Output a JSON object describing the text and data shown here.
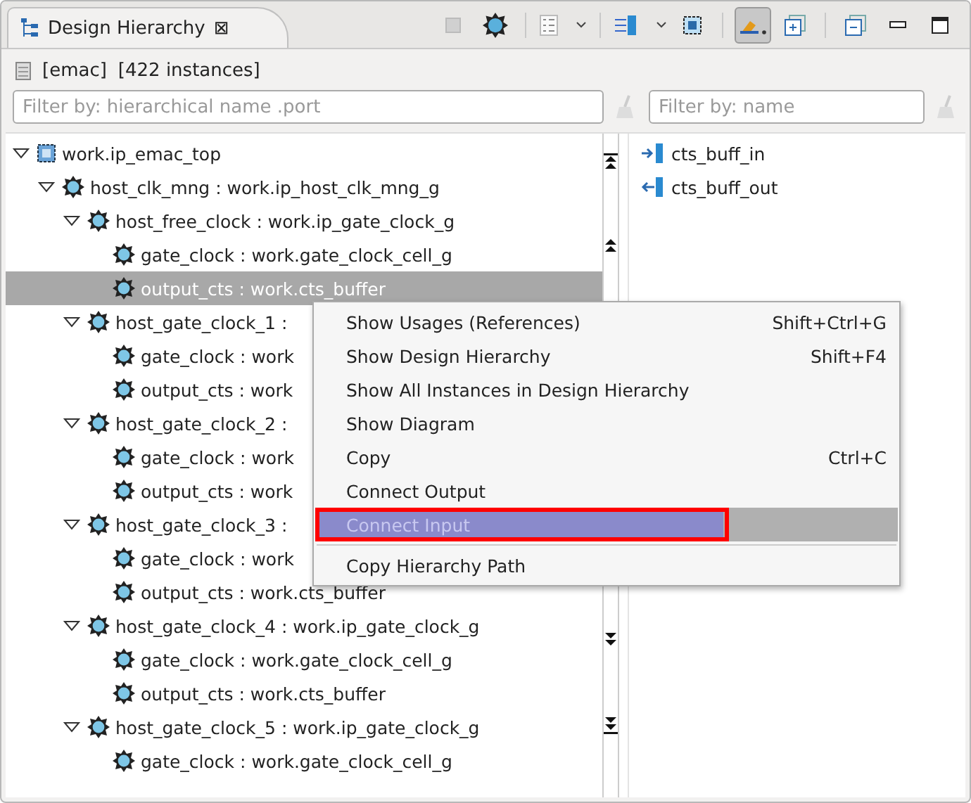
{
  "tab": {
    "title": "Design Hierarchy",
    "close": "⊠"
  },
  "toolbar": [
    {
      "kind": "stop",
      "disabled": true
    },
    {
      "kind": "bug"
    },
    {
      "kind": "list",
      "dropdown": true
    },
    {
      "kind": "columns",
      "dropdown": true
    },
    {
      "kind": "chip"
    },
    {
      "kind": "highlight",
      "pressed": true
    },
    {
      "kind": "expand"
    },
    {
      "kind": "collapse"
    },
    {
      "kind": "minimize"
    },
    {
      "kind": "maximize"
    }
  ],
  "summary": {
    "unit": "[emac]",
    "count": "[422 instances]"
  },
  "filters": {
    "tree": {
      "placeholder": "Filter by: hierarchical name .port"
    },
    "ports": {
      "placeholder": "Filter by: name"
    }
  },
  "tree": [
    {
      "label": "work.ip_emac_top",
      "kind": "module",
      "expanded": true,
      "selected": false,
      "children": [
        {
          "label": "host_clk_mng : work.ip_host_clk_mng_g",
          "kind": "instance",
          "expanded": true,
          "selected": false,
          "children": [
            {
              "label": "host_free_clock : work.ip_gate_clock_g",
              "kind": "instance",
              "expanded": true,
              "selected": false,
              "children": [
                {
                  "label": "gate_clock : work.gate_clock_cell_g",
                  "kind": "instance",
                  "selected": false
                },
                {
                  "label": "output_cts : work.cts_buffer",
                  "kind": "instance",
                  "selected": true
                }
              ]
            },
            {
              "label": "host_gate_clock_1 :",
              "kind": "instance",
              "expanded": true,
              "selected": false,
              "children": [
                {
                  "label": "gate_clock : work",
                  "kind": "instance",
                  "selected": false
                },
                {
                  "label": "output_cts : work",
                  "kind": "instance",
                  "selected": false
                }
              ]
            },
            {
              "label": "host_gate_clock_2 :",
              "kind": "instance",
              "expanded": true,
              "selected": false,
              "children": [
                {
                  "label": "gate_clock : work",
                  "kind": "instance",
                  "selected": false
                },
                {
                  "label": "output_cts : work",
                  "kind": "instance",
                  "selected": false
                }
              ]
            },
            {
              "label": "host_gate_clock_3 :",
              "kind": "instance",
              "expanded": true,
              "selected": false,
              "children": [
                {
                  "label": "gate_clock : work",
                  "kind": "instance",
                  "selected": false
                },
                {
                  "label": "output_cts : work.cts_buffer",
                  "kind": "instance",
                  "selected": false
                }
              ]
            },
            {
              "label": "host_gate_clock_4 : work.ip_gate_clock_g",
              "kind": "instance",
              "expanded": true,
              "selected": false,
              "children": [
                {
                  "label": "gate_clock : work.gate_clock_cell_g",
                  "kind": "instance",
                  "selected": false
                },
                {
                  "label": "output_cts : work.cts_buffer",
                  "kind": "instance",
                  "selected": false
                }
              ]
            },
            {
              "label": "host_gate_clock_5 : work.ip_gate_clock_g",
              "kind": "instance",
              "expanded": true,
              "selected": false,
              "children": [
                {
                  "label": "gate_clock : work.gate_clock_cell_g",
                  "kind": "instance",
                  "selected": false
                }
              ]
            }
          ]
        }
      ]
    }
  ],
  "nav": [
    {
      "kind": "top"
    },
    {
      "kind": "up"
    },
    {
      "kind": "down"
    },
    {
      "kind": "bottom"
    }
  ],
  "ports": [
    {
      "label": "cts_buff_in",
      "kind": "in"
    },
    {
      "label": "cts_buff_out",
      "kind": "out"
    }
  ],
  "menu": [
    {
      "label": "Show Usages (References)",
      "shortcut": "Shift+Ctrl+G",
      "disabled": false,
      "selected": false
    },
    {
      "label": "Show Design Hierarchy",
      "shortcut": "Shift+F4",
      "disabled": false,
      "selected": false
    },
    {
      "label": "Show All Instances in Design Hierarchy",
      "disabled": false,
      "selected": false
    },
    {
      "label": "Show Diagram",
      "disabled": false,
      "selected": false
    },
    {
      "label": "Copy",
      "shortcut": "Ctrl+C",
      "disabled": false,
      "selected": false
    },
    {
      "label": "Connect Output",
      "disabled": false,
      "selected": false
    },
    {
      "label": "Connect Input",
      "disabled": true,
      "selected": true,
      "outlined": true
    },
    {
      "kind": "separator"
    },
    {
      "label": "Copy Hierarchy Path",
      "disabled": false,
      "selected": false
    }
  ]
}
